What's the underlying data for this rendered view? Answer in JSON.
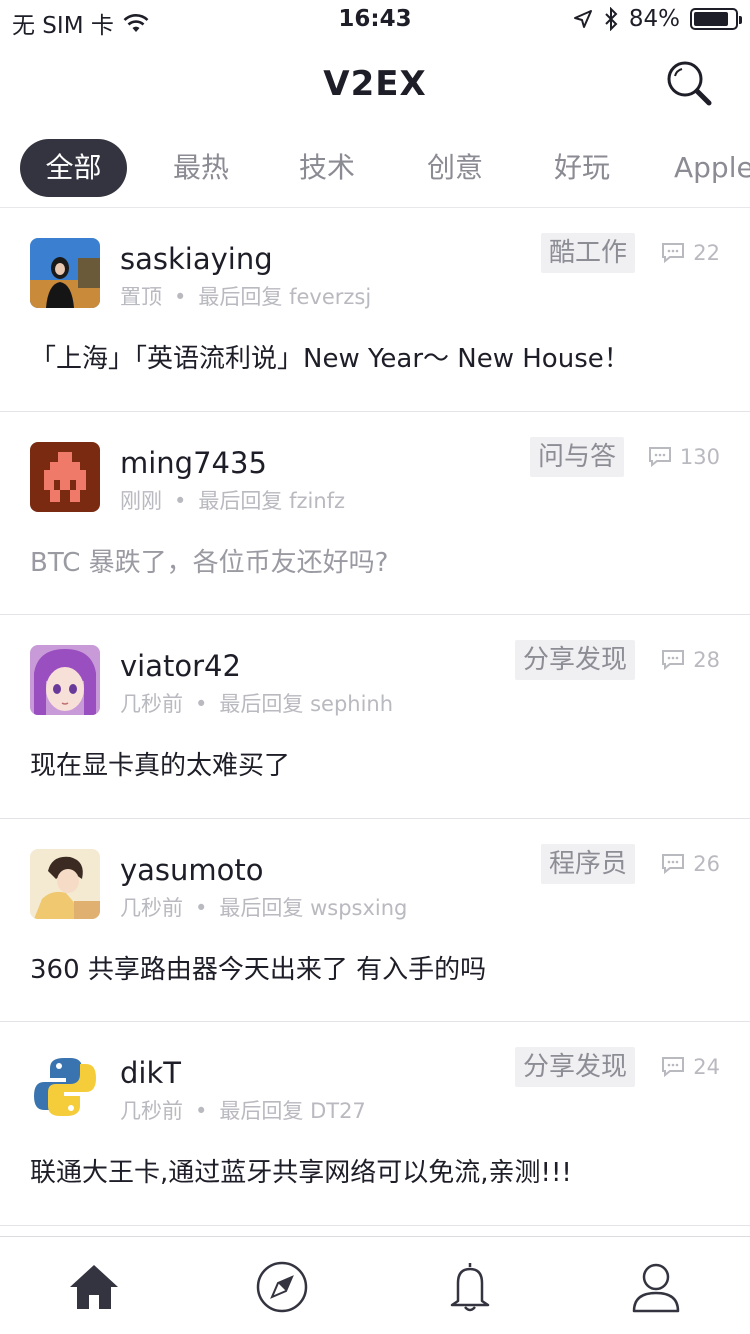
{
  "status_bar": {
    "carrier": "无 SIM 卡",
    "time": "16:43",
    "battery": "84%",
    "battery_level": 0.84
  },
  "nav": {
    "title": "V2EX",
    "search_icon": "search-icon"
  },
  "tabs": [
    {
      "label": "全部",
      "active": true
    },
    {
      "label": "最热",
      "active": false
    },
    {
      "label": "技术",
      "active": false
    },
    {
      "label": "创意",
      "active": false
    },
    {
      "label": "好玩",
      "active": false
    },
    {
      "label": "Apple",
      "active": false
    }
  ],
  "topics": [
    {
      "username": "saskiaying",
      "time": "置顶",
      "last_reply_label": "最后回复",
      "last_reply_user": "feverzsj",
      "node": "酷工作",
      "replies": "22",
      "title": "「上海」「英语流利说」New Year～ New House！",
      "read": false
    },
    {
      "username": "ming7435",
      "time": "刚刚",
      "last_reply_label": "最后回复",
      "last_reply_user": "fzinfz",
      "node": "问与答",
      "replies": "130",
      "title": "BTC 暴跌了，各位币友还好吗?",
      "read": true
    },
    {
      "username": "viator42",
      "time": "几秒前",
      "last_reply_label": "最后回复",
      "last_reply_user": "sephinh",
      "node": "分享发现",
      "replies": "28",
      "title": "现在显卡真的太难买了",
      "read": false
    },
    {
      "username": "yasumoto",
      "time": "几秒前",
      "last_reply_label": "最后回复",
      "last_reply_user": "wspsxing",
      "node": "程序员",
      "replies": "26",
      "title": "360 共享路由器今天出来了 有入手的吗",
      "read": false
    },
    {
      "username": "dikT",
      "time": "几秒前",
      "last_reply_label": "最后回复",
      "last_reply_user": "DT27",
      "node": "分享发现",
      "replies": "24",
      "title": "联通大王卡,通过蓝牙共享网络可以免流,亲测!!!",
      "read": false
    }
  ],
  "tab_bar": [
    {
      "icon": "home-icon",
      "active": true
    },
    {
      "icon": "compass-icon",
      "active": false
    },
    {
      "icon": "bell-icon",
      "active": false
    },
    {
      "icon": "user-icon",
      "active": false
    }
  ],
  "colors": {
    "accent": "#33343f",
    "tag_bg": "#f0f0f2",
    "muted": "#b9b9c0"
  }
}
